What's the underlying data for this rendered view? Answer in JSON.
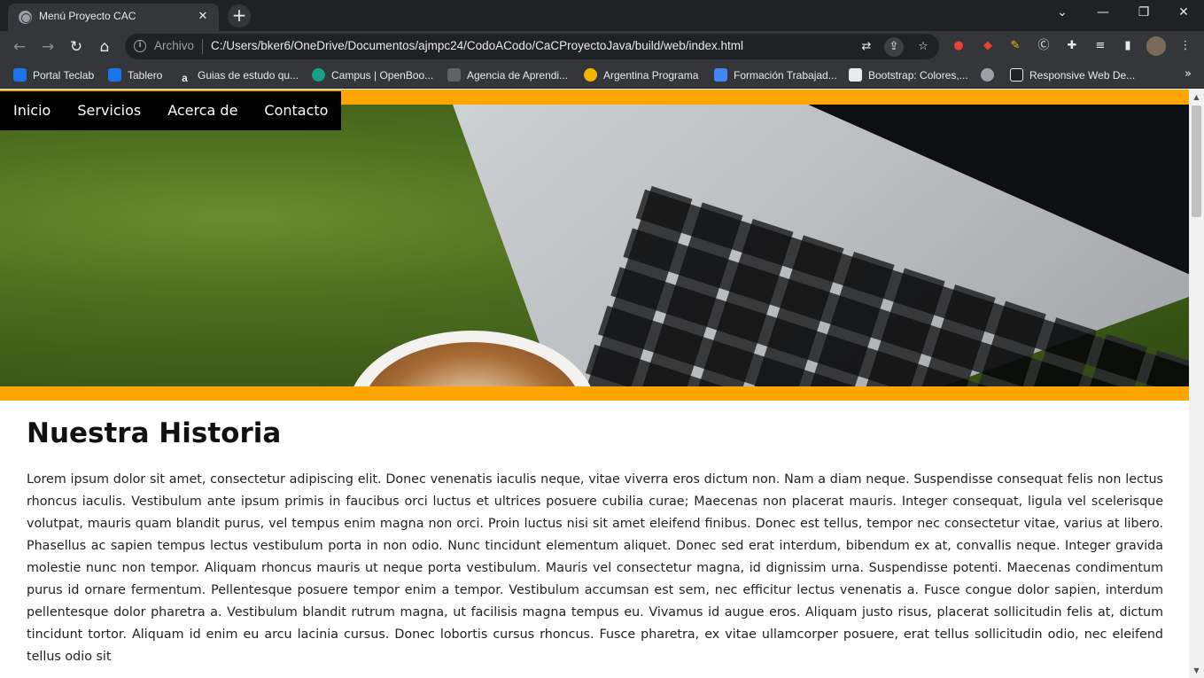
{
  "browser": {
    "tab_title": "Menú Proyecto CAC",
    "tab_close": "✕",
    "new_tab": "+",
    "window_controls": {
      "dropdown": "⌄",
      "minimize": "—",
      "restore": "❐",
      "close": "✕"
    },
    "omnibox": {
      "scheme_label": "Archivo",
      "url": "C:/Users/bker6/OneDrive/Documentos/ajmpc24/CodoACodo/CaCProyectoJava/build/web/index.html"
    },
    "bookmarks": [
      {
        "label": "Portal Teclab",
        "icon": "teclab-icon",
        "color": "#1a73e8"
      },
      {
        "label": "Tablero",
        "icon": "teclab-icon",
        "color": "#1a73e8"
      },
      {
        "label": "Guias de estudo qu...",
        "icon": "a-letter-icon",
        "color": "#35363a"
      },
      {
        "label": "Campus | OpenBoo...",
        "icon": "openbootcamp-icon",
        "color": "#16a085"
      },
      {
        "label": "Agencia de Aprendi...",
        "icon": "ba-icon",
        "color": "#5f6368"
      },
      {
        "label": "Argentina Programa",
        "icon": "argentina-icon",
        "color": "#f5b400"
      },
      {
        "label": "Formación Trabajad...",
        "icon": "formacion-icon",
        "color": "#4285f4"
      },
      {
        "label": "Bootstrap: Colores,...",
        "icon": "bootstrap-icon",
        "color": "#e8eaed"
      },
      {
        "label": "",
        "icon": "globe-icon",
        "color": "#9aa0a6"
      },
      {
        "label": "Responsive Web De...",
        "icon": "responsive-icon",
        "color": "#202124"
      }
    ],
    "bookmarks_more": "»"
  },
  "page": {
    "menu": [
      "Inicio",
      "Servicios",
      "Acerca de",
      "Contacto"
    ],
    "heading": "Nuestra Historia",
    "paragraph": "Lorem ipsum dolor sit amet, consectetur adipiscing elit. Donec venenatis iaculis neque, vitae viverra eros dictum non. Nam a diam neque. Suspendisse consequat felis non lectus rhoncus iaculis. Vestibulum ante ipsum primis in faucibus orci luctus et ultrices posuere cubilia curae; Maecenas non placerat mauris. Integer consequat, ligula vel scelerisque volutpat, mauris quam blandit purus, vel tempus enim magna non orci. Proin luctus nisi sit amet eleifend finibus. Donec est tellus, tempor nec consectetur vitae, varius at libero. Phasellus ac sapien tempus lectus vestibulum porta in non odio. Nunc tincidunt elementum aliquet. Donec sed erat interdum, bibendum ex at, convallis neque. Integer gravida molestie nunc non tempor. Aliquam rhoncus mauris ut neque porta vestibulum. Mauris vel consectetur magna, id dignissim urna. Suspendisse potenti. Maecenas condimentum purus id ornare fermentum. Pellentesque posuere tempor enim a tempor. Vestibulum accumsan est sem, nec efficitur lectus venenatis a. Fusce congue dolor sapien, interdum pellentesque dolor pharetra a. Vestibulum blandit rutrum magna, ut facilisis magna tempus eu. Vivamus id augue eros. Aliquam justo risus, placerat sollicitudin felis at, dictum tincidunt tortor. Aliquam id enim eu arcu lacinia cursus. Donec lobortis cursus rhoncus. Fusce pharetra, ex vitae ullamcorper posuere, erat tellus sollicitudin odio, nec eleifend tellus odio sit",
    "accent_color": "#ffa500"
  }
}
